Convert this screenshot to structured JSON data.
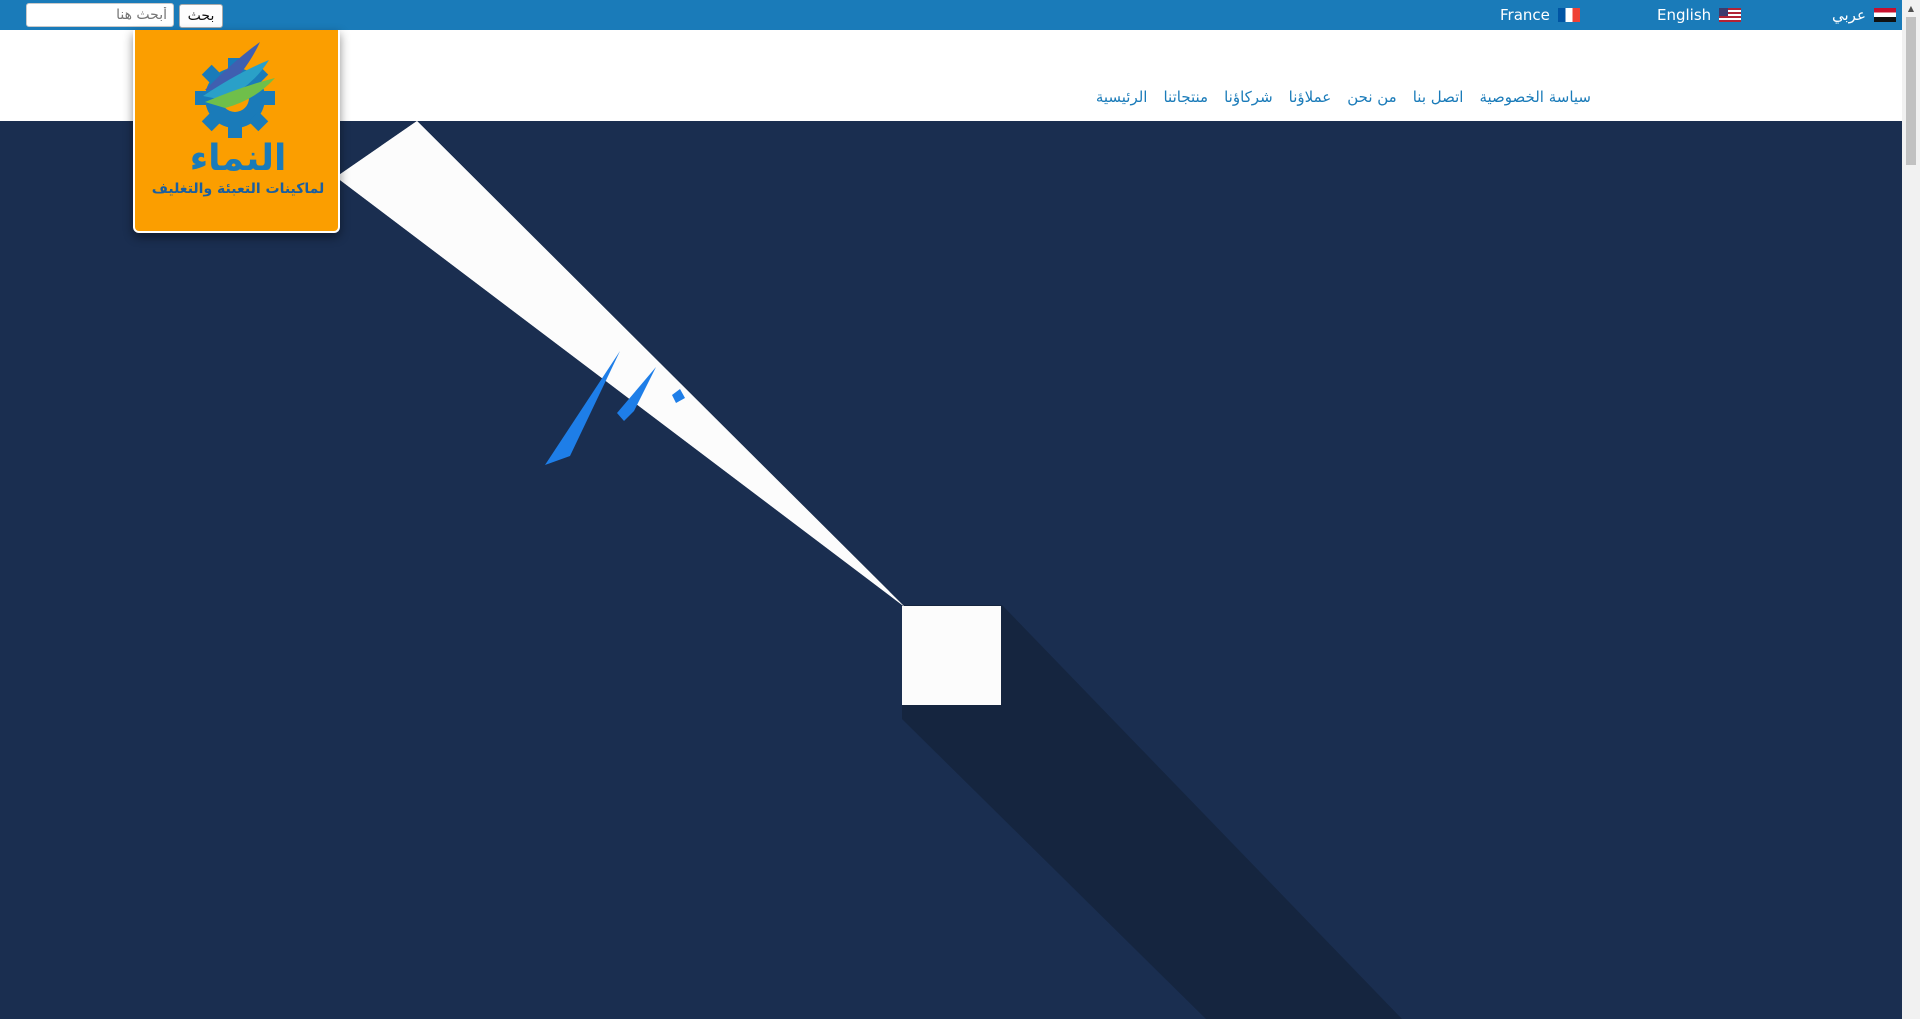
{
  "topbar": {
    "search_placeholder": "أبحث هنا",
    "search_button": "بحث",
    "languages": [
      {
        "label": "عربي",
        "flag": "egypt-flag"
      },
      {
        "label": "English",
        "flag": "us-flag"
      },
      {
        "label": "France",
        "flag": "france-flag"
      }
    ]
  },
  "nav": {
    "items": [
      "الرئيسية",
      "منتجاتنا",
      "شركاؤنا",
      "عملاؤنا",
      "من نحن",
      "اتصل بنا",
      "سياسة الخصوصية"
    ]
  },
  "logo": {
    "name": "النماء",
    "tagline": "لماكينات التعبئة والتغليف"
  },
  "colors": {
    "topbar": "#1a7bb9",
    "nav_link": "#1a7bb9",
    "logo_bg": "#fb9e00",
    "hero_bg": "#1a2e50",
    "hero_accent": "#1e7ee8"
  }
}
